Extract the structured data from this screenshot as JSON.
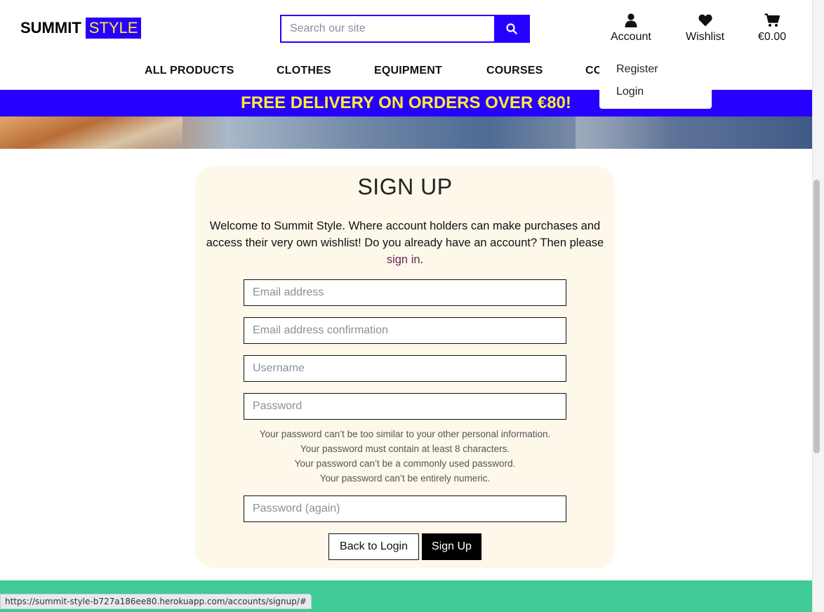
{
  "brand": {
    "part1": "SUMMIT",
    "part2": "STYLE"
  },
  "search": {
    "placeholder": "Search our site",
    "icon": "search-icon"
  },
  "header_icons": {
    "account": {
      "label": "Account",
      "icon": "user-icon"
    },
    "wishlist": {
      "label": "Wishlist",
      "icon": "heart-icon"
    },
    "cart": {
      "label": "€0.00",
      "icon": "cart-icon"
    }
  },
  "nav": {
    "items": [
      "ALL PRODUCTS",
      "CLOTHES",
      "EQUIPMENT",
      "COURSES",
      "CO"
    ]
  },
  "account_menu": {
    "items": [
      "Register",
      "Login"
    ]
  },
  "banner": {
    "text": "FREE DELIVERY ON ORDERS OVER €80!"
  },
  "signup": {
    "title": "SIGN UP",
    "intro": "Welcome to Summit Style. Where account holders can make purchases and access their very own wishlist! Do you already have an account? Then please ",
    "signin_link": "sign in",
    "intro_end": ".",
    "fields": {
      "email": "Email address",
      "email_confirm": "Email address confirmation",
      "username": "Username",
      "password": "Password",
      "password_again": "Password (again)"
    },
    "help": [
      "Your password can’t be too similar to your other personal information.",
      "Your password must contain at least 8 characters.",
      "Your password can’t be a commonly used password.",
      "Your password can’t be entirely numeric."
    ],
    "back_button": "Back to Login",
    "submit_button": "Sign Up"
  },
  "status_bar": {
    "url": "https://summit-style-b727a186ee80.herokuapp.com/accounts/signup/#"
  },
  "colors": {
    "brand_blue": "#2600ff",
    "brand_yellow": "#ffeb3b",
    "card_bg": "#fdf8ea",
    "footer": "#3ecb96"
  }
}
